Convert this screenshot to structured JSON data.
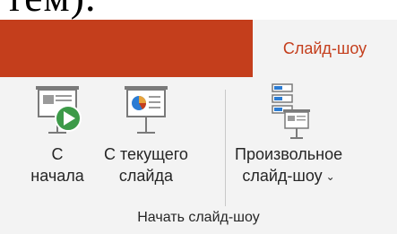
{
  "document_fragment": "тем).",
  "tab": {
    "label": "Слайд-шоу"
  },
  "commands": [
    {
      "line1": "С",
      "line2": "начала",
      "icon": "slideshow-from-beginning-icon"
    },
    {
      "line1": "С текущего",
      "line2": "слайда",
      "icon": "slideshow-from-current-icon"
    },
    {
      "line1": "Произвольное",
      "line2": "слайд-шоу",
      "icon": "custom-slideshow-icon",
      "has_dropdown": true
    }
  ],
  "group": {
    "label": "Начать слайд-шоу"
  },
  "colors": {
    "accent": "#c43e1c",
    "ribbon": "#f3f3f3",
    "icon_blue": "#2b7cd3",
    "icon_green": "#3c9a48"
  }
}
